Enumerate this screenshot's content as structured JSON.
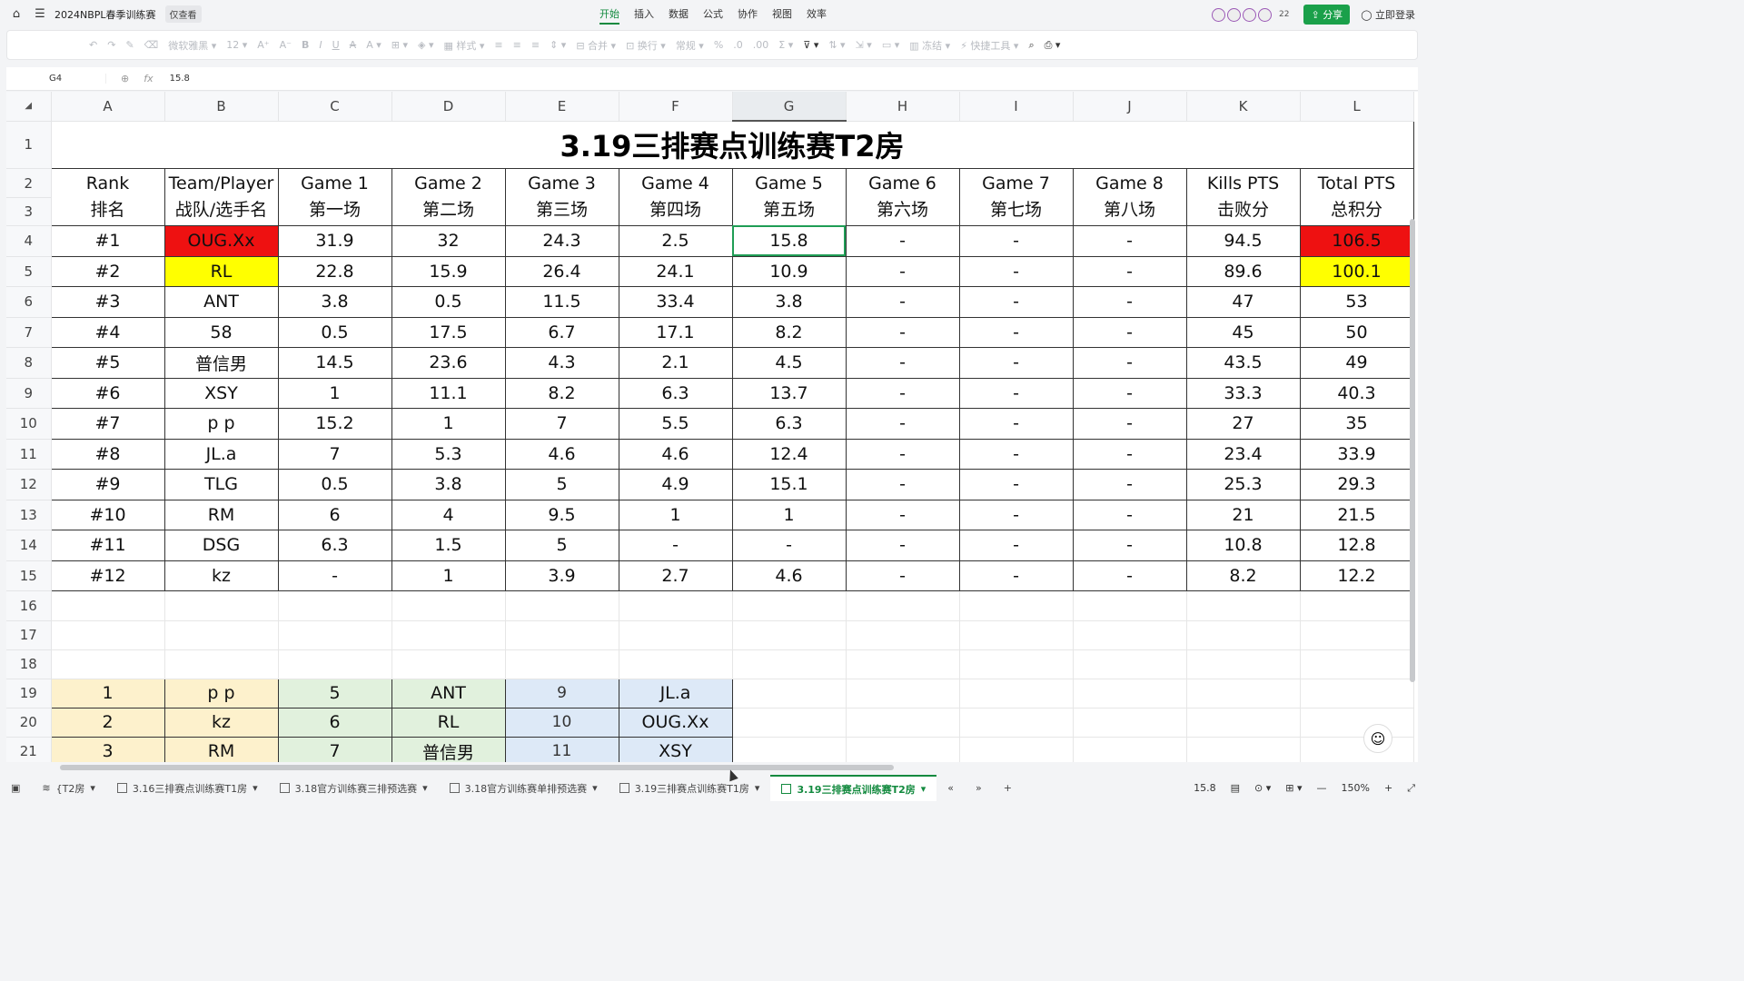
{
  "app": {
    "doc_title": "2024NBPL春季训练赛",
    "readonly_label": "仅查看",
    "menu": [
      "开始",
      "插入",
      "数据",
      "公式",
      "协作",
      "视图",
      "效率"
    ],
    "active_menu": "开始",
    "collab_count": "22",
    "share_label": "分享",
    "login_label": "立即登录"
  },
  "toolbar": {
    "font_name": "微软雅黑",
    "font_size": "12",
    "style_label": "样式",
    "merge_label": "合并",
    "wrap_label": "换行",
    "format_label": "常规",
    "freeze_label": "冻结",
    "quick_tools_label": "快捷工具"
  },
  "formula_bar": {
    "cell_ref": "G4",
    "fx": "fx",
    "value": "15.8"
  },
  "sheet": {
    "columns": [
      "A",
      "B",
      "C",
      "D",
      "E",
      "F",
      "G",
      "H",
      "I",
      "J",
      "K",
      "L"
    ],
    "selected_column": "G",
    "rows": [
      "1",
      "2",
      "3",
      "4",
      "5",
      "6",
      "7",
      "8",
      "9",
      "10",
      "11",
      "12",
      "13",
      "14",
      "15",
      "16",
      "17",
      "18",
      "19",
      "20",
      "21"
    ],
    "title": "3.19三排赛点训练赛T2房",
    "headers_en": [
      "Rank",
      "Team/Player",
      "Game 1",
      "Game 2",
      "Game 3",
      "Game 4",
      "Game 5",
      "Game 6",
      "Game 7",
      "Game 8",
      "Kills PTS",
      "Total PTS"
    ],
    "headers_cn": [
      "排名",
      "战队/选手名",
      "第一场",
      "第二场",
      "第三场",
      "第四场",
      "第五场",
      "第六场",
      "第七场",
      "第八场",
      "击败分",
      "总积分"
    ],
    "data": [
      [
        "#1",
        "OUG.Xx",
        "31.9",
        "32",
        "24.3",
        "2.5",
        "15.8",
        "-",
        "-",
        "-",
        "94.5",
        "106.5"
      ],
      [
        "#2",
        "RL",
        "22.8",
        "15.9",
        "26.4",
        "24.1",
        "10.9",
        "-",
        "-",
        "-",
        "89.6",
        "100.1"
      ],
      [
        "#3",
        "ANT",
        "3.8",
        "0.5",
        "11.5",
        "33.4",
        "3.8",
        "-",
        "-",
        "-",
        "47",
        "53"
      ],
      [
        "#4",
        "58",
        "0.5",
        "17.5",
        "6.7",
        "17.1",
        "8.2",
        "-",
        "-",
        "-",
        "45",
        "50"
      ],
      [
        "#5",
        "普信男",
        "14.5",
        "23.6",
        "4.3",
        "2.1",
        "4.5",
        "-",
        "-",
        "-",
        "43.5",
        "49"
      ],
      [
        "#6",
        "XSY",
        "1",
        "11.1",
        "8.2",
        "6.3",
        "13.7",
        "-",
        "-",
        "-",
        "33.3",
        "40.3"
      ],
      [
        "#7",
        "p p",
        "15.2",
        "1",
        "7",
        "5.5",
        "6.3",
        "-",
        "-",
        "-",
        "27",
        "35"
      ],
      [
        "#8",
        "JL.a",
        "7",
        "5.3",
        "4.6",
        "4.6",
        "12.4",
        "-",
        "-",
        "-",
        "23.4",
        "33.9"
      ],
      [
        "#9",
        "TLG",
        "0.5",
        "3.8",
        "5",
        "4.9",
        "15.1",
        "-",
        "-",
        "-",
        "25.3",
        "29.3"
      ],
      [
        "#10",
        "RM",
        "6",
        "4",
        "9.5",
        "1",
        "1",
        "-",
        "-",
        "-",
        "21",
        "21.5"
      ],
      [
        "#11",
        "DSG",
        "6.3",
        "1.5",
        "5",
        "-",
        "-",
        "-",
        "-",
        "-",
        "10.8",
        "12.8"
      ],
      [
        "#12",
        "kz",
        "-",
        "1",
        "3.9",
        "2.7",
        "4.6",
        "-",
        "-",
        "-",
        "8.2",
        "12.2"
      ]
    ],
    "lower_table": [
      [
        "1",
        "p p",
        "5",
        "ANT",
        "9",
        "JL.a"
      ],
      [
        "2",
        "kz",
        "6",
        "RL",
        "10",
        "OUG.Xx"
      ],
      [
        "3",
        "RM",
        "7",
        "普信男",
        "11",
        "XSY"
      ]
    ],
    "colors": {
      "first_place": "#ee1111",
      "second_place": "#ffff00",
      "selection": "#1f9d55"
    }
  },
  "sheet_tabs": {
    "first_partial": "{T2房",
    "tabs": [
      "3.16三排赛点训练赛T1房",
      "3.18官方训练赛三排预选赛",
      "3.18官方训练赛单排预选赛",
      "3.19三排赛点训练赛T1房",
      "3.19三排赛点训练赛T2房"
    ],
    "active_tab": "3.19三排赛点训练赛T2房"
  },
  "status": {
    "cell_value": "15.8",
    "zoom": "150%"
  }
}
